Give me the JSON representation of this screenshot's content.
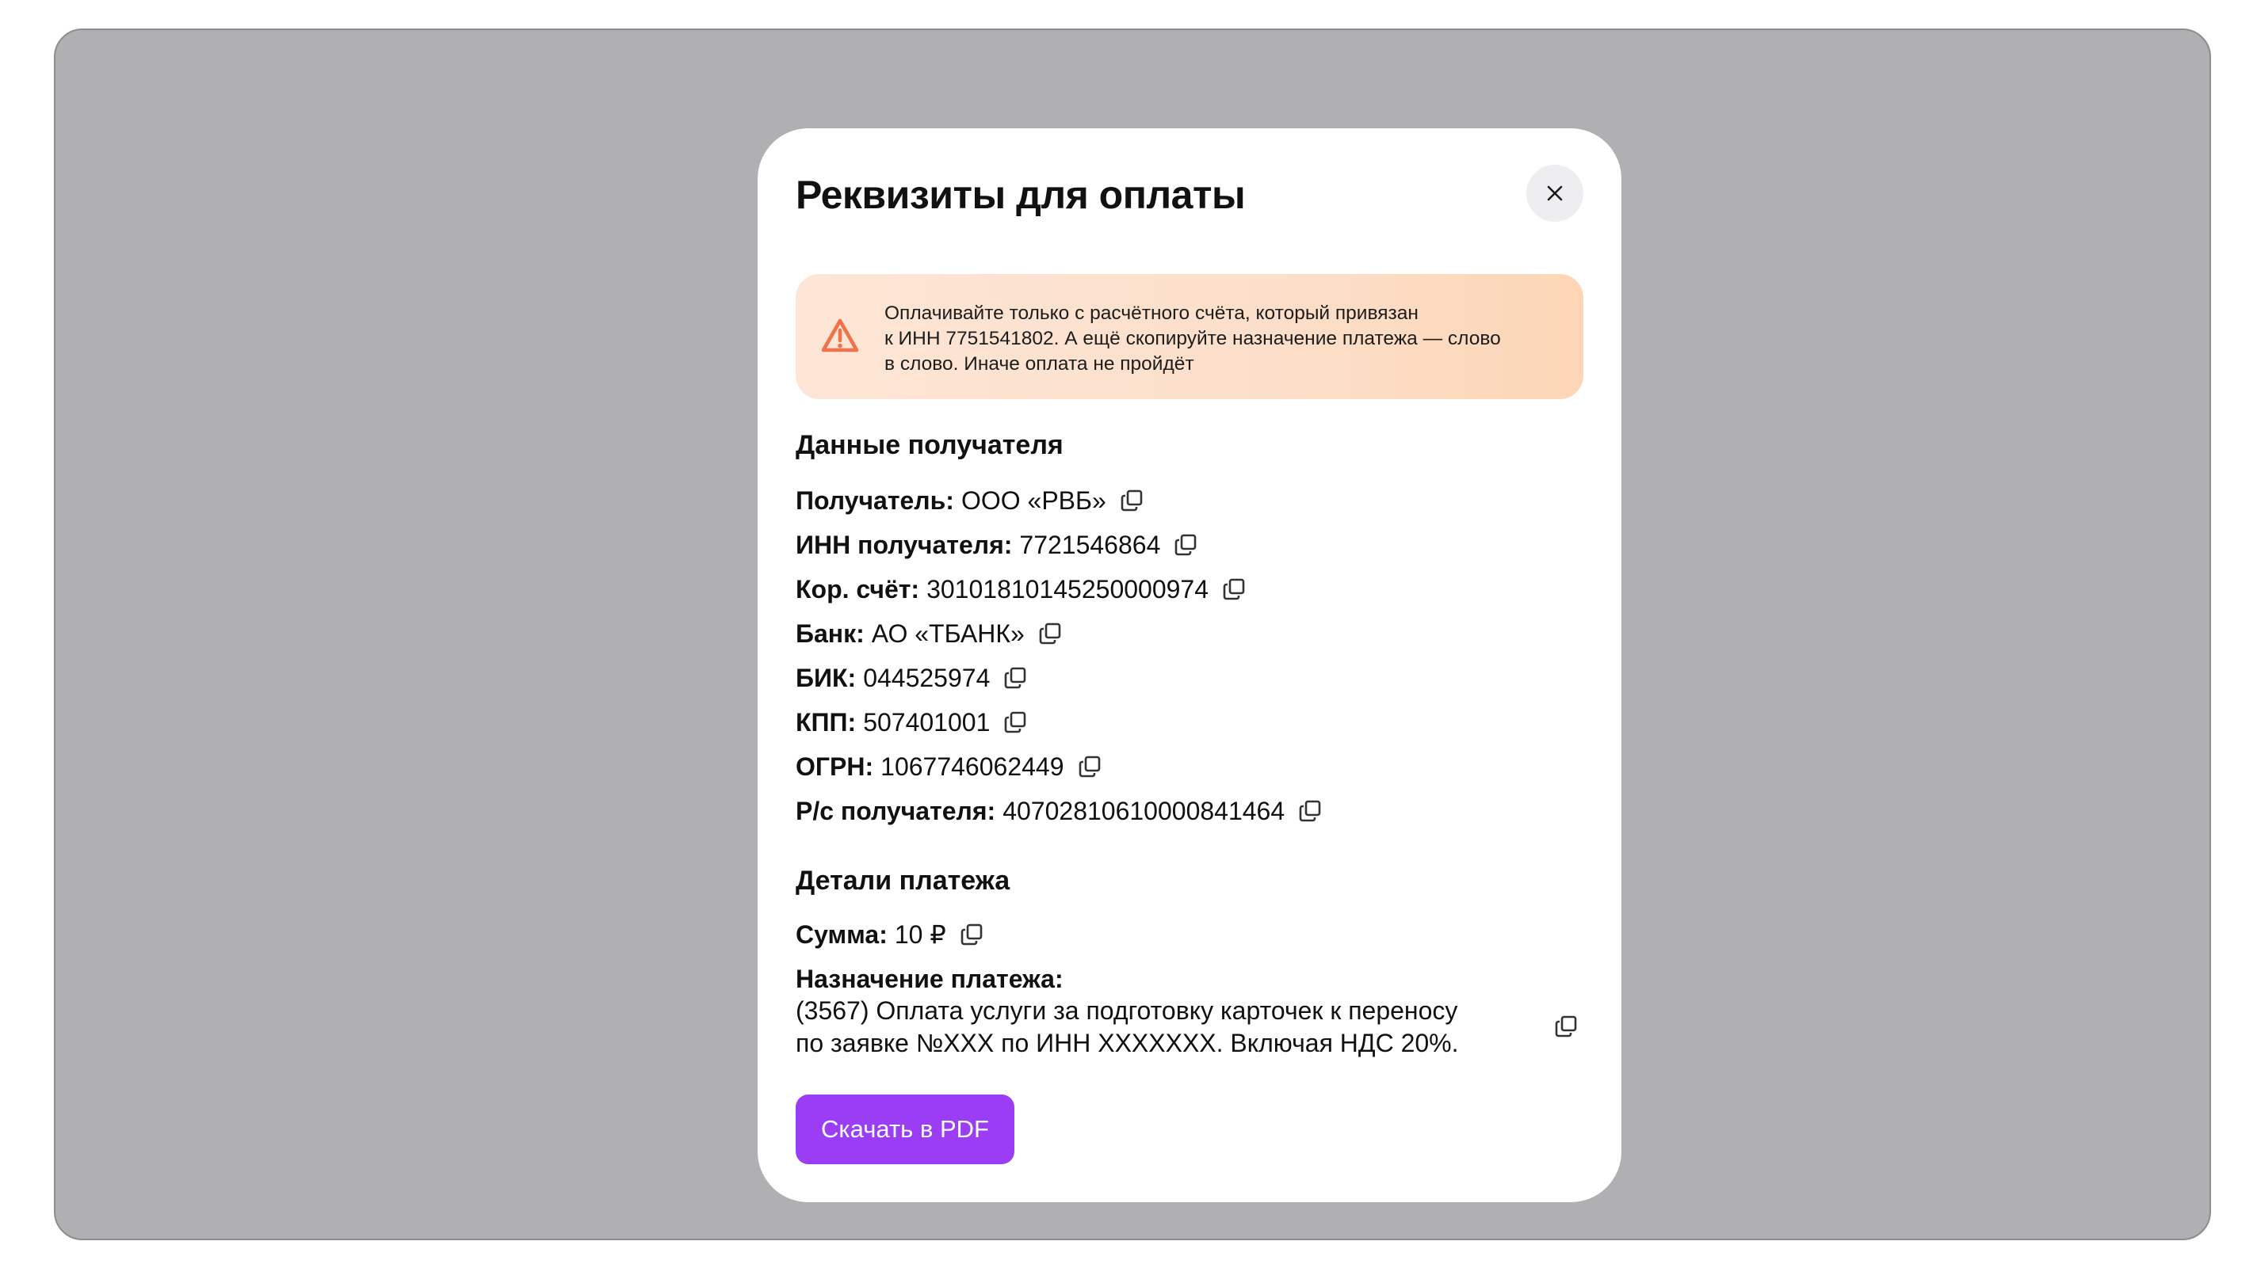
{
  "modal": {
    "title": "Реквизиты для оплаты",
    "close_icon": "close-icon"
  },
  "alert": {
    "icon": "warning-triangle-icon",
    "line1": "Оплачивайте только с расчётного счёта, который привязан",
    "line2": "к ИНН 7751541802. А ещё скопируйте назначение платежа — слово",
    "line3": "в слово. Иначе оплата не пройдёт",
    "icon_color": "#f0714a"
  },
  "recipient": {
    "title": "Данные получателя",
    "rows": [
      {
        "label": "Получатель:",
        "value": "ООО «РВБ»"
      },
      {
        "label": "ИНН получателя:",
        "value": "7721546864"
      },
      {
        "label": "Кор. счёт:",
        "value": "30101810145250000974"
      },
      {
        "label": "Банк:",
        "value": "АО «ТБАНК»"
      },
      {
        "label": "БИК:",
        "value": "044525974"
      },
      {
        "label": "КПП:",
        "value": "507401001"
      },
      {
        "label": "ОГРН:",
        "value": "1067746062449"
      },
      {
        "label": "Р/с получателя:",
        "value": "40702810610000841464"
      }
    ]
  },
  "payment": {
    "title": "Детали платежа",
    "amount_label": "Сумма:",
    "amount_value": "10 ₽",
    "purpose_label": "Назначение платежа:",
    "purpose_line1": "(3567) Оплата услуги за подготовку карточек к переносу",
    "purpose_line2": "по заявке №ХХХ по ИНН ХХХХХХХ. Включая НДС 20%."
  },
  "actions": {
    "download_label": "Скачать в PDF",
    "button_color": "#9b3df5"
  },
  "icons": {
    "copy": "copy-icon"
  }
}
